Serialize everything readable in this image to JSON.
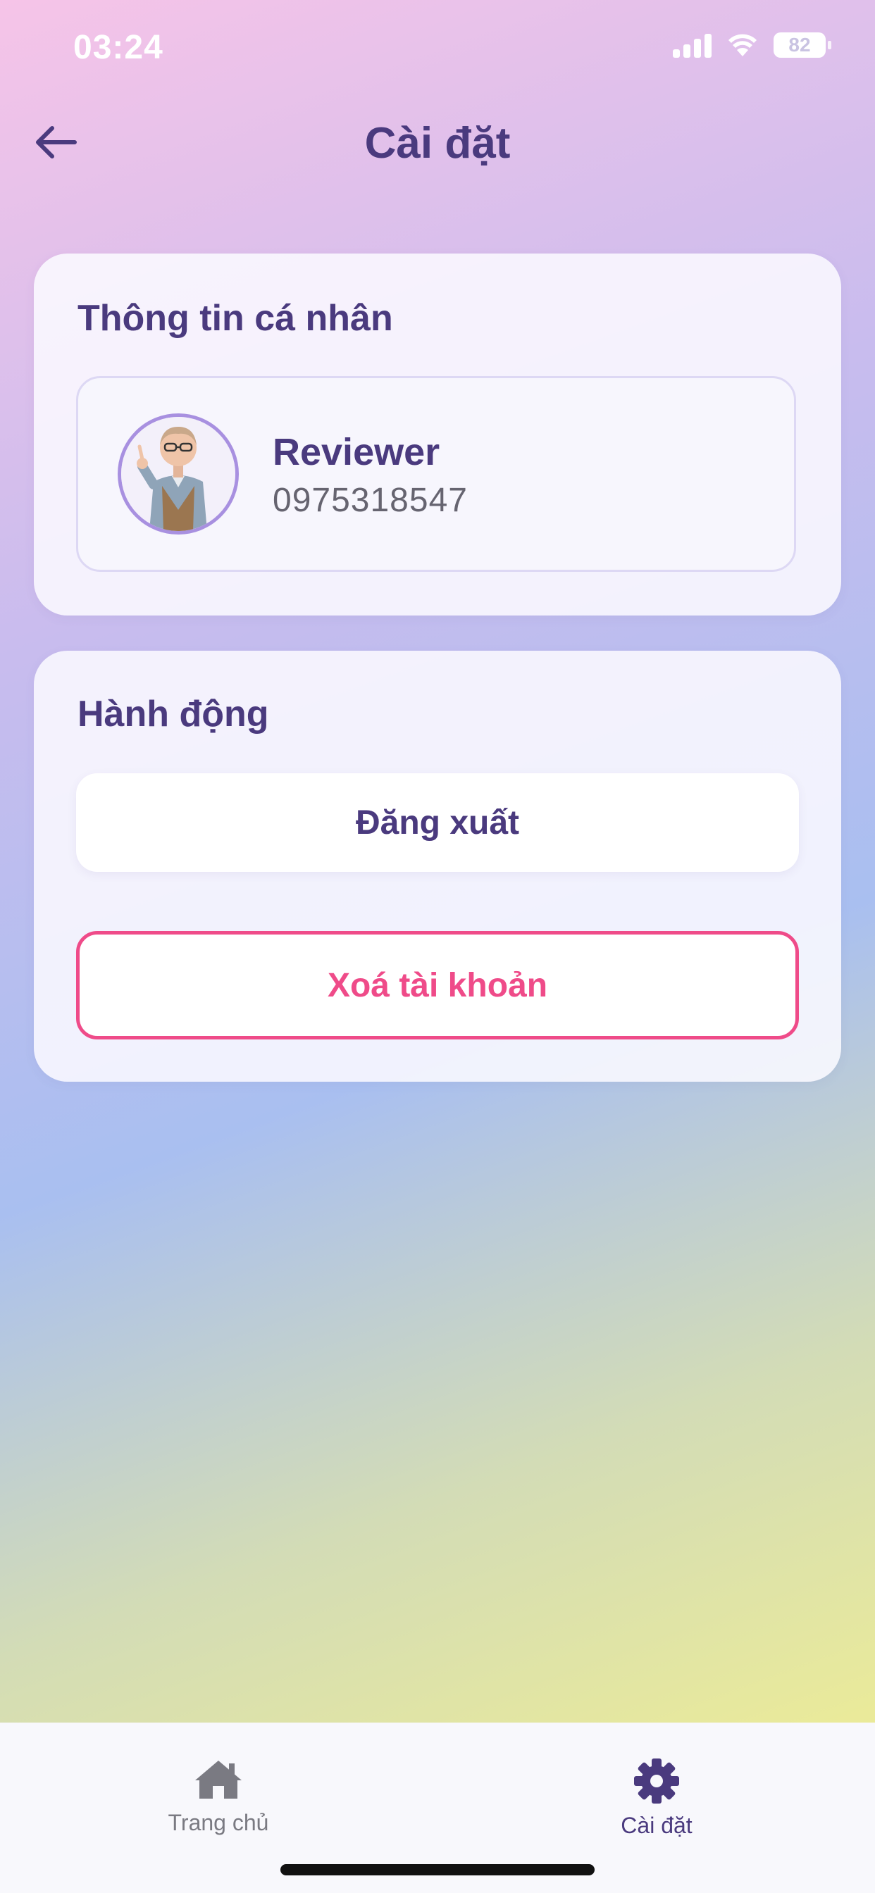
{
  "status_bar": {
    "time": "03:24",
    "battery": "82"
  },
  "header": {
    "title": "Cài đặt",
    "back_icon": "arrow-left-icon"
  },
  "profile_card": {
    "title": "Thông tin cá nhân",
    "name": "Reviewer",
    "phone": "0975318547"
  },
  "actions_card": {
    "title": "Hành động",
    "logout_label": "Đăng xuất",
    "delete_label": "Xoá tài khoản"
  },
  "tabbar": {
    "tabs": [
      {
        "label": "Trang chủ",
        "icon": "home-icon",
        "active": false
      },
      {
        "label": "Cài đặt",
        "icon": "gear-icon",
        "active": true
      }
    ]
  },
  "colors": {
    "primary": "#4a3a7e",
    "danger": "#ef4b89",
    "inactive_tab": "#7a7a82"
  }
}
